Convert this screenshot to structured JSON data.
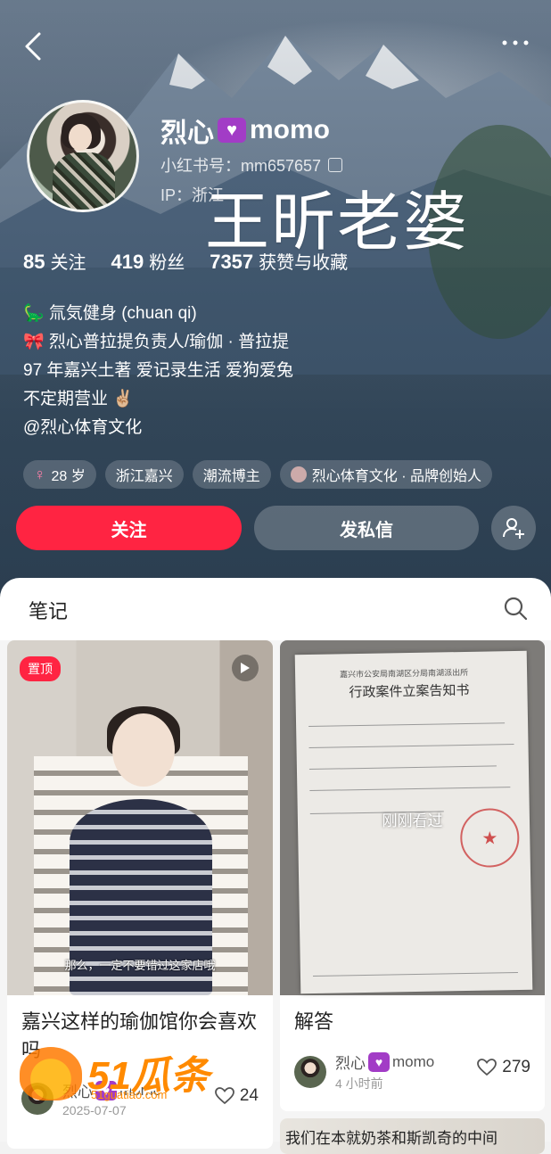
{
  "header": {
    "username": "烈心",
    "username_suffix": "momo",
    "red_id": "小红书号：mm657657",
    "ip": "IP：浙江",
    "overlay_text": "王昕老婆"
  },
  "stats": [
    {
      "value": "85",
      "label": "关注"
    },
    {
      "value": "419",
      "label": "粉丝"
    },
    {
      "value": "7357",
      "label": "获赞与收藏"
    }
  ],
  "bio": [
    "🦕 氚気健身 (chuan qi)",
    "🎀 烈心普拉提负责人/瑜伽 · 普拉提",
    "97 年嘉兴土著 爱记录生活 爱狗爱兔",
    "不定期营业 ✌🏼",
    "@烈心体育文化"
  ],
  "tags": [
    {
      "label": "28 岁",
      "icon": "female-icon"
    },
    {
      "label": "浙江嘉兴"
    },
    {
      "label": "潮流博主"
    },
    {
      "label": "烈心体育文化 · 品牌创始人",
      "icon": "brand-avatar"
    }
  ],
  "actions": {
    "follow": "关注",
    "message": "发私信"
  },
  "tabs": {
    "notes": "笔记"
  },
  "cards": [
    {
      "badge": "置顶",
      "subtitle": "那么，一定不要错过这家店哦",
      "title": "嘉兴这样的瑜伽馆你会喜欢吗",
      "author": "烈心",
      "author_suffix": "momo",
      "date": "2025-07-07",
      "likes": "24"
    },
    {
      "doc_head": "嘉兴市公安局南湖区分局南湖派出所",
      "doc_title": "行政案件立案告知书",
      "overlay": "刚刚看过",
      "title": "解答",
      "author": "烈心",
      "author_suffix": "momo",
      "date": "4 小时前",
      "likes": "279"
    },
    {
      "title": "我们在本就奶茶和斯凯奇的中间"
    }
  ],
  "watermark": {
    "text": "51瓜条",
    "sub": "51guatiao.com"
  },
  "colors": {
    "accent": "#ff2442",
    "badge_purple": "#a23cc6"
  }
}
